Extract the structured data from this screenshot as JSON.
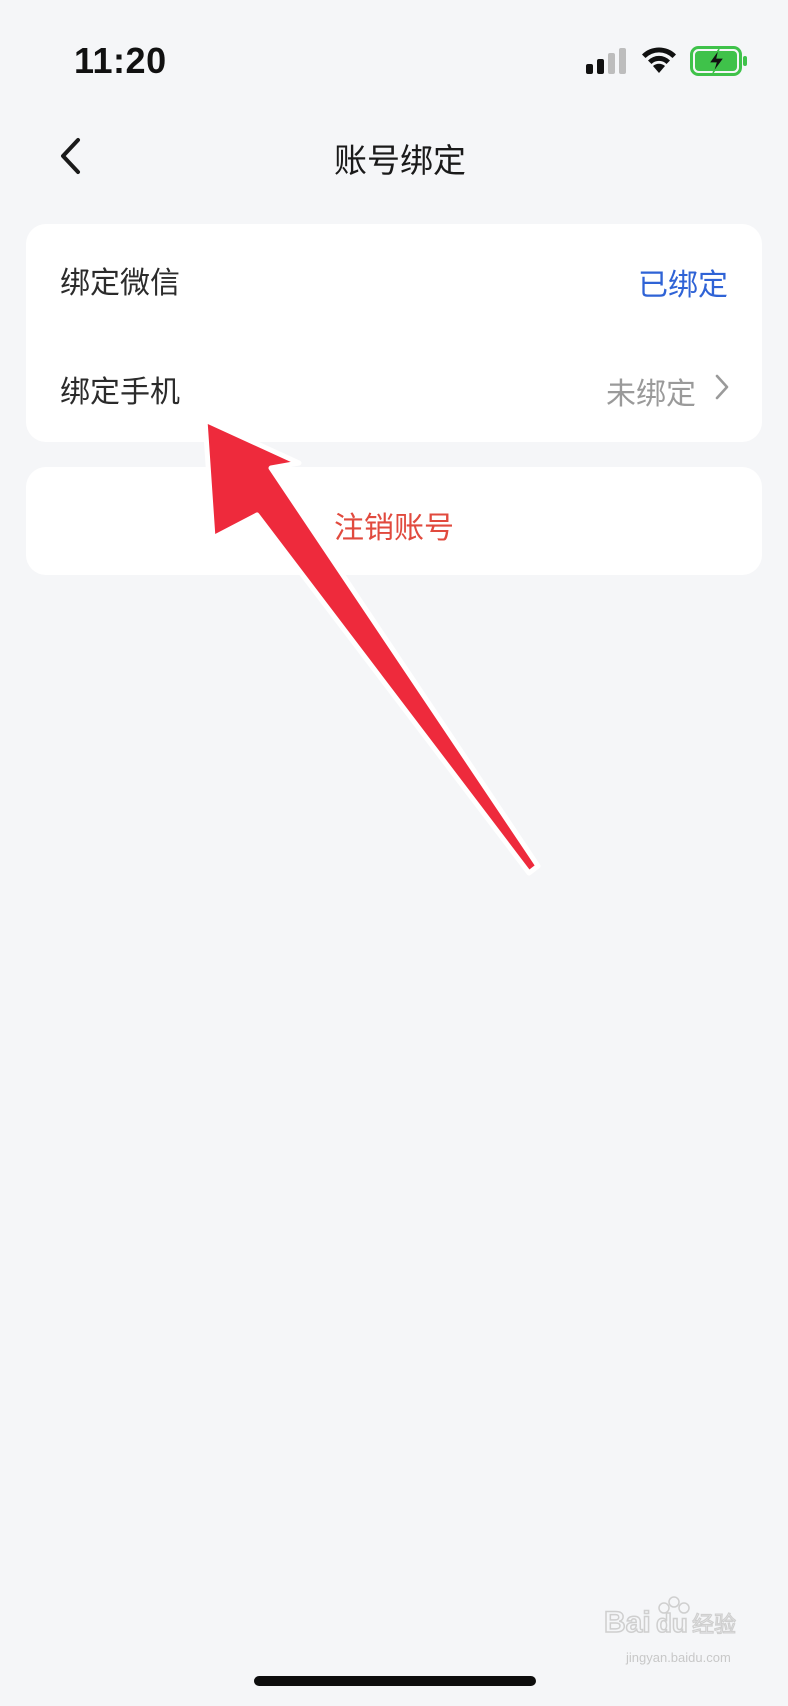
{
  "status_bar": {
    "time": "11:20",
    "icons": [
      "signal-icon",
      "wifi-icon",
      "battery-charging-icon"
    ],
    "battery_color": "#3fc24a"
  },
  "nav": {
    "title": "账号绑定",
    "back_icon": "chevron-left-icon"
  },
  "bindings": [
    {
      "label": "绑定微信",
      "status": "已绑定",
      "status_color": "#2f63d6"
    },
    {
      "label": "绑定手机",
      "status": "未绑定",
      "status_color": "#9a9a9a"
    }
  ],
  "cancel_account": {
    "label": "注销账号",
    "color": "#e14a3e"
  },
  "annotation": {
    "icon": "red-arrow-annotation",
    "color": "#ee2a3c"
  },
  "watermark": {
    "logo": "Baidu经验",
    "url": "jingyan.baidu.com"
  }
}
